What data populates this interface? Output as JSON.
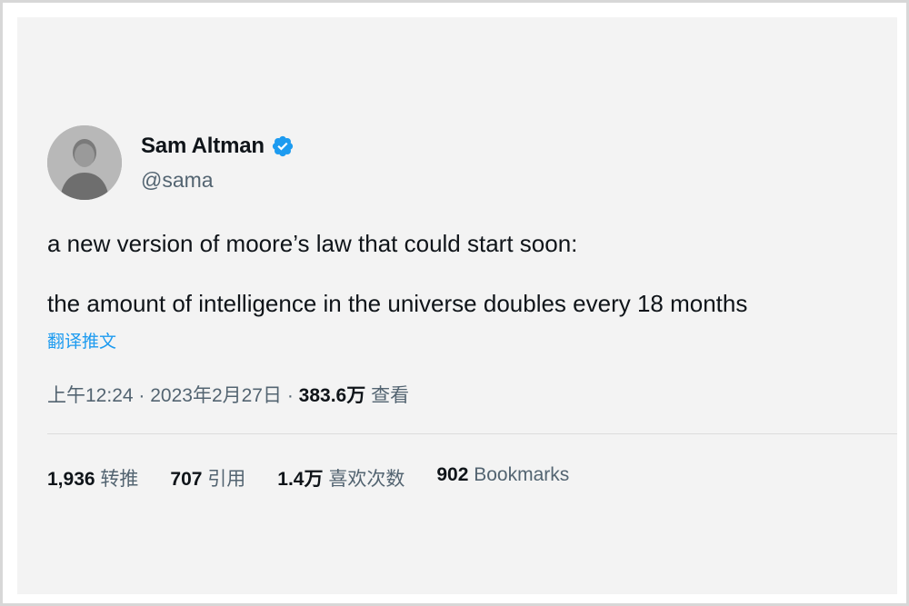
{
  "author": {
    "name": "Sam Altman",
    "handle": "@sama",
    "verified": true
  },
  "tweet": {
    "line1": "a new version of moore’s law that could start soon:",
    "line2": "the amount of intelligence in the universe doubles every 18 months",
    "translate_label": "翻译推文"
  },
  "meta": {
    "time": "上午12:24",
    "separator": " · ",
    "date": "2023年2月27日",
    "views_count": "383.6万",
    "views_label": "查看"
  },
  "stats": {
    "retweets": {
      "count": "1,936",
      "label": "转推"
    },
    "quotes": {
      "count": "707",
      "label": "引用"
    },
    "likes": {
      "count": "1.4万",
      "label": "喜欢次数"
    },
    "bookmarks": {
      "count": "902",
      "label": "Bookmarks"
    }
  },
  "colors": {
    "background": "#f3f3f3",
    "text": "#0f1419",
    "secondary_text": "#536471",
    "accent": "#1d9bf0"
  },
  "icons": {
    "verified": "verified-badge-icon"
  }
}
